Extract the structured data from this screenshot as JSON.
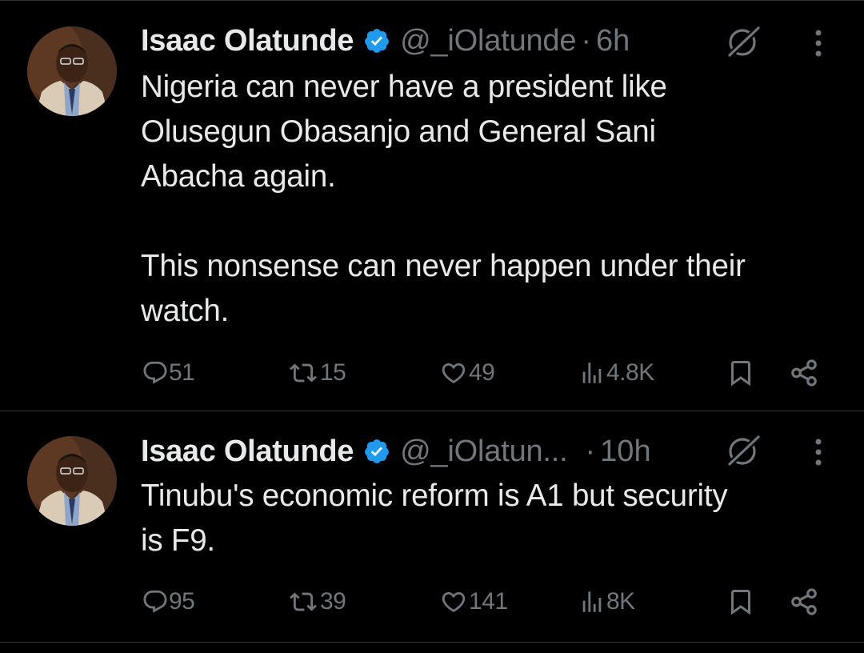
{
  "colors": {
    "background": "#000000",
    "text": "#e7e9ea",
    "secondary": "#71767b",
    "verified": "#1d9bf0",
    "divider": "#2f3336"
  },
  "tweets": [
    {
      "author_name": "Isaac Olatunde",
      "handle": "@_iOlatunde",
      "separator": "·",
      "time": "6h",
      "text": "Nigeria can never have a president like\nOlusegun Obasanjo and General Sani\nAbacha again.\n\nThis nonsense can never happen under their\nwatch.",
      "replies": "51",
      "reposts": "15",
      "likes": "49",
      "views": "4.8K",
      "icons": [
        "verified-badge-icon",
        "grok-icon",
        "more-icon",
        "reply-icon",
        "repost-icon",
        "like-icon",
        "views-icon",
        "bookmark-icon",
        "share-icon"
      ]
    },
    {
      "author_name": "Isaac Olatunde",
      "handle": "@_iOlatun...",
      "separator": "·",
      "time": "10h",
      "text": "Tinubu's economic reform is A1 but security\nis F9.",
      "replies": "95",
      "reposts": "39",
      "likes": "141",
      "views": "8K",
      "icons": [
        "verified-badge-icon",
        "grok-icon",
        "more-icon",
        "reply-icon",
        "repost-icon",
        "like-icon",
        "views-icon",
        "bookmark-icon",
        "share-icon"
      ]
    }
  ]
}
